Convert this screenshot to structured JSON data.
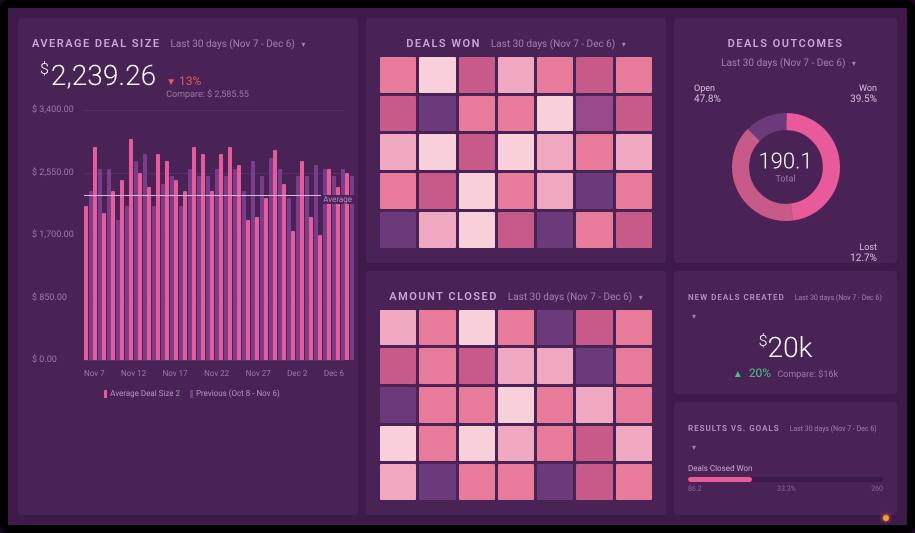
{
  "avg_deal_size": {
    "title": "AVERAGE DEAL SIZE",
    "period": "Last 30 days (Nov 7 - Dec 6)",
    "currency": "$",
    "value": "2,239.26",
    "delta_pct": "13%",
    "delta_dir": "down",
    "compare_label": "Compare: $ 2,585.55",
    "legend_current": "Average Deal Size 2",
    "legend_previous": "Previous (Oct 8 - Nov 6)",
    "avg_line_label": "Average"
  },
  "deals_won": {
    "title": "DEALS WON",
    "period": "Last 30 days (Nov 7 - Dec 6)"
  },
  "amount_closed": {
    "title": "AMOUNT CLOSED",
    "period": "Last 30 days (Nov 7 - Dec 6)"
  },
  "outcomes": {
    "title": "DEALS OUTCOMES",
    "period": "Last 30 days (Nov 7 - Dec 6)",
    "total_value": "190.1",
    "total_label": "Total",
    "segments": {
      "open": {
        "label": "Open",
        "pct": "47.8%"
      },
      "won": {
        "label": "Won",
        "pct": "39.5%"
      },
      "lost": {
        "label": "Lost",
        "pct": "12.7%"
      }
    }
  },
  "new_deals": {
    "title": "NEW DEALS CREATED",
    "period": "Last 30 days (Nov 7 - Dec 6)",
    "currency": "$",
    "value": "20k",
    "delta_pct": "20%",
    "delta_dir": "up",
    "compare_label": "Compare: $16k"
  },
  "results": {
    "title": "RESULTS VS. GOALS",
    "period": "Last 30 days (Nov 7 - Dec 6)",
    "row1_label": "Deals Closed Won",
    "row1_value": "86.2",
    "row1_mid": "33.3%",
    "row1_max": "260"
  },
  "chart_data": [
    {
      "type": "bar",
      "title": "Average Deal Size",
      "ylabel": "$",
      "ylim": [
        0,
        3400
      ],
      "y_ticks": [
        "$ 3,400.00",
        "$ 2,550.00",
        "$ 1,700.00",
        "$ 850.00",
        "$ 0.00"
      ],
      "x_ticks": [
        "Nov 7",
        "Nov 12",
        "Nov 17",
        "Nov 22",
        "Nov 27",
        "Dec 2",
        "Dec 6"
      ],
      "average_line": 2239.26,
      "series": [
        {
          "name": "Average Deal Size 2",
          "color": "#e85a9a",
          "values": [
            2100,
            2900,
            2000,
            2300,
            2450,
            3000,
            2550,
            2350,
            2800,
            2700,
            2450,
            2300,
            2900,
            2800,
            2300,
            2800,
            2900,
            2650,
            1900,
            1950,
            2200,
            2850,
            2400,
            1750,
            2700,
            1950,
            1700,
            2600,
            2350,
            2550
          ]
        },
        {
          "name": "Previous (Oct 8 - Nov 6)",
          "color": "#7a3d8a",
          "values": [
            2300,
            2600,
            2600,
            1900,
            2100,
            2700,
            2800,
            2100,
            2400,
            2500,
            2100,
            2600,
            2500,
            2500,
            2600,
            2500,
            2600,
            2300,
            2700,
            2500,
            2750,
            2600,
            2200,
            2500,
            2500,
            2650,
            2600,
            2500,
            2600,
            2500
          ]
        }
      ]
    },
    {
      "type": "heatmap",
      "title": "Deals Won",
      "rows": 5,
      "cols": 7,
      "color_scale": [
        "#6a3a7a",
        "#9a4a8a",
        "#c85a8a",
        "#e87a9a",
        "#f0a8c0",
        "#f8d0da"
      ],
      "intensity": [
        [
          3,
          5,
          2,
          4,
          3,
          2,
          3
        ],
        [
          2,
          0,
          3,
          3,
          5,
          1,
          2
        ],
        [
          4,
          5,
          2,
          5,
          4,
          3,
          4
        ],
        [
          3,
          2,
          5,
          3,
          4,
          0,
          3
        ],
        [
          0,
          4,
          5,
          2,
          0,
          3,
          2
        ]
      ]
    },
    {
      "type": "heatmap",
      "title": "Amount Closed",
      "rows": 5,
      "cols": 7,
      "color_scale": [
        "#6a3a7a",
        "#9a4a8a",
        "#c85a8a",
        "#e87a9a",
        "#f0a8c0",
        "#f8d0da"
      ],
      "intensity": [
        [
          4,
          3,
          5,
          3,
          0,
          2,
          3
        ],
        [
          2,
          3,
          2,
          4,
          4,
          0,
          3
        ],
        [
          0,
          3,
          3,
          5,
          3,
          4,
          3
        ],
        [
          5,
          3,
          5,
          4,
          3,
          2,
          4
        ],
        [
          4,
          0,
          3,
          3,
          0,
          2,
          3
        ]
      ]
    },
    {
      "type": "pie",
      "title": "Deals Outcomes",
      "total": 190.1,
      "series": [
        {
          "name": "Open",
          "value": 47.8,
          "color": "#e85a9a"
        },
        {
          "name": "Won",
          "value": 39.5,
          "color": "#c85a8a"
        },
        {
          "name": "Lost",
          "value": 12.7,
          "color": "#6a3a7a"
        }
      ]
    }
  ]
}
